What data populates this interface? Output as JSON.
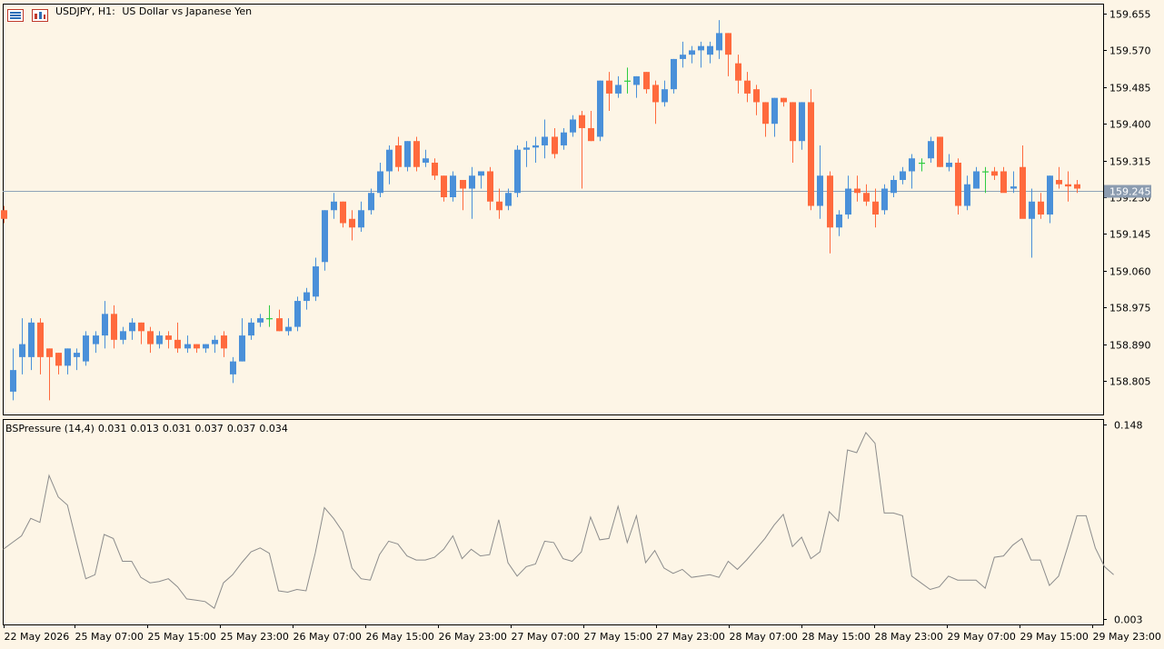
{
  "header": {
    "symbol": "USDJPY, H1:",
    "description": "US Dollar vs Japanese Yen"
  },
  "indicator": {
    "name": "BSPressure (14,4)",
    "values": [
      "0.031",
      "0.013",
      "0.031",
      "0.037",
      "0.037",
      "0.034"
    ]
  },
  "icons": [
    "menu-list-icon",
    "chart-window-icon"
  ],
  "colors": {
    "background": "#fdf5e6",
    "bull": "#4a90d9",
    "bear": "#ff6a3d",
    "doji": "#2ecc40",
    "price_line": "#8fa3b8",
    "grid_border": "#000000",
    "indicator_line": "#8c8c8c",
    "current_price_bg": "#8c9cb0"
  },
  "chart_data": [
    {
      "type": "candlestick",
      "symbol": "USDJPY",
      "timeframe": "H1",
      "title": "USDJPY, H1:  US Dollar vs Japanese Yen",
      "y_ticks": [
        "159.655",
        "159.570",
        "159.485",
        "159.400",
        "159.315",
        "159.230",
        "159.145",
        "159.060",
        "158.975",
        "158.890",
        "158.805"
      ],
      "ylim": [
        158.74,
        159.665
      ],
      "current_price": "159.245",
      "x_ticks": [
        "22 May 2026",
        "25 May 07:00",
        "25 May 15:00",
        "25 May 23:00",
        "26 May 07:00",
        "26 May 15:00",
        "26 May 23:00",
        "27 May 07:00",
        "27 May 15:00",
        "27 May 23:00",
        "28 May 07:00",
        "28 May 15:00",
        "28 May 23:00",
        "29 May 07:00",
        "29 May 15:00",
        "29 May 23:00"
      ],
      "candles": [
        [
          159.2,
          159.21,
          159.17,
          159.18
        ],
        [
          158.78,
          158.88,
          158.76,
          158.83
        ],
        [
          158.86,
          158.95,
          158.82,
          158.89
        ],
        [
          158.86,
          158.95,
          158.83,
          158.94
        ],
        [
          158.94,
          158.95,
          158.82,
          158.86
        ],
        [
          158.88,
          158.88,
          158.76,
          158.86
        ],
        [
          158.87,
          158.87,
          158.82,
          158.84
        ],
        [
          158.84,
          158.88,
          158.82,
          158.88
        ],
        [
          158.86,
          158.88,
          158.83,
          158.87
        ],
        [
          158.85,
          158.92,
          158.84,
          158.91
        ],
        [
          158.89,
          158.92,
          158.87,
          158.91
        ],
        [
          158.91,
          158.99,
          158.88,
          158.96
        ],
        [
          158.96,
          158.98,
          158.88,
          158.9
        ],
        [
          158.9,
          158.93,
          158.89,
          158.92
        ],
        [
          158.92,
          158.95,
          158.9,
          158.94
        ],
        [
          158.94,
          158.94,
          158.89,
          158.92
        ],
        [
          158.92,
          158.93,
          158.87,
          158.89
        ],
        [
          158.89,
          158.92,
          158.88,
          158.91
        ],
        [
          158.91,
          158.92,
          158.88,
          158.9
        ],
        [
          158.9,
          158.94,
          158.87,
          158.88
        ],
        [
          158.88,
          158.91,
          158.87,
          158.89
        ],
        [
          158.89,
          158.89,
          158.87,
          158.88
        ],
        [
          158.88,
          158.89,
          158.87,
          158.89
        ],
        [
          158.89,
          158.91,
          158.87,
          158.9
        ],
        [
          158.91,
          158.92,
          158.86,
          158.88
        ],
        [
          158.82,
          158.86,
          158.8,
          158.85
        ],
        [
          158.85,
          158.95,
          158.85,
          158.91
        ],
        [
          158.91,
          158.95,
          158.9,
          158.94
        ],
        [
          158.94,
          158.96,
          158.93,
          158.95
        ],
        [
          158.95,
          158.98,
          158.93,
          158.95
        ],
        [
          158.95,
          158.97,
          158.92,
          158.92
        ],
        [
          158.92,
          158.95,
          158.91,
          158.93
        ],
        [
          158.93,
          159.0,
          158.92,
          158.99
        ],
        [
          158.99,
          159.02,
          158.97,
          159.01
        ],
        [
          159.0,
          159.09,
          158.99,
          159.07
        ],
        [
          159.08,
          159.2,
          159.06,
          159.2
        ],
        [
          159.2,
          159.24,
          159.18,
          159.22
        ],
        [
          159.22,
          159.22,
          159.16,
          159.17
        ],
        [
          159.18,
          159.2,
          159.13,
          159.16
        ],
        [
          159.16,
          159.22,
          159.15,
          159.2
        ],
        [
          159.2,
          159.25,
          159.19,
          159.24
        ],
        [
          159.24,
          159.31,
          159.23,
          159.29
        ],
        [
          159.29,
          159.35,
          159.26,
          159.34
        ],
        [
          159.35,
          159.37,
          159.29,
          159.3
        ],
        [
          159.3,
          159.36,
          159.29,
          159.36
        ],
        [
          159.36,
          159.37,
          159.29,
          159.3
        ],
        [
          159.31,
          159.34,
          159.3,
          159.32
        ],
        [
          159.31,
          159.32,
          159.27,
          159.28
        ],
        [
          159.28,
          159.28,
          159.22,
          159.23
        ],
        [
          159.23,
          159.29,
          159.22,
          159.28
        ],
        [
          159.27,
          159.27,
          159.2,
          159.25
        ],
        [
          159.25,
          159.3,
          159.18,
          159.28
        ],
        [
          159.28,
          159.29,
          159.25,
          159.29
        ],
        [
          159.29,
          159.3,
          159.2,
          159.22
        ],
        [
          159.22,
          159.25,
          159.18,
          159.2
        ],
        [
          159.21,
          159.25,
          159.2,
          159.24
        ],
        [
          159.24,
          159.35,
          159.23,
          159.34
        ],
        [
          159.34,
          159.36,
          159.3,
          159.345
        ],
        [
          159.345,
          159.37,
          159.31,
          159.35
        ],
        [
          159.35,
          159.41,
          159.32,
          159.37
        ],
        [
          159.37,
          159.39,
          159.32,
          159.33
        ],
        [
          159.35,
          159.39,
          159.34,
          159.38
        ],
        [
          159.38,
          159.42,
          159.37,
          159.41
        ],
        [
          159.42,
          159.43,
          159.25,
          159.39
        ],
        [
          159.39,
          159.43,
          159.36,
          159.36
        ],
        [
          159.37,
          159.5,
          159.36,
          159.5
        ],
        [
          159.5,
          159.52,
          159.43,
          159.47
        ],
        [
          159.47,
          159.51,
          159.46,
          159.49
        ],
        [
          159.5,
          159.53,
          159.47,
          159.5
        ],
        [
          159.49,
          159.51,
          159.46,
          159.51
        ],
        [
          159.52,
          159.52,
          159.47,
          159.48
        ],
        [
          159.49,
          159.5,
          159.4,
          159.45
        ],
        [
          159.45,
          159.5,
          159.44,
          159.48
        ],
        [
          159.48,
          159.55,
          159.47,
          159.55
        ],
        [
          159.55,
          159.59,
          159.53,
          159.56
        ],
        [
          159.56,
          159.58,
          159.54,
          159.57
        ],
        [
          159.57,
          159.59,
          159.53,
          159.58
        ],
        [
          159.56,
          159.59,
          159.54,
          159.58
        ],
        [
          159.57,
          159.64,
          159.55,
          159.61
        ],
        [
          159.61,
          159.61,
          159.51,
          159.56
        ],
        [
          159.54,
          159.56,
          159.47,
          159.5
        ],
        [
          159.5,
          159.52,
          159.45,
          159.47
        ],
        [
          159.48,
          159.49,
          159.42,
          159.45
        ],
        [
          159.45,
          159.45,
          159.37,
          159.4
        ],
        [
          159.4,
          159.46,
          159.37,
          159.46
        ],
        [
          159.46,
          159.46,
          159.44,
          159.45
        ],
        [
          159.45,
          159.45,
          159.31,
          159.36
        ],
        [
          159.36,
          159.45,
          159.34,
          159.45
        ],
        [
          159.45,
          159.48,
          159.2,
          159.21
        ],
        [
          159.21,
          159.35,
          159.18,
          159.28
        ],
        [
          159.28,
          159.29,
          159.1,
          159.16
        ],
        [
          159.16,
          159.2,
          159.14,
          159.19
        ],
        [
          159.19,
          159.28,
          159.18,
          159.25
        ],
        [
          159.25,
          159.28,
          159.22,
          159.24
        ],
        [
          159.24,
          159.26,
          159.21,
          159.22
        ],
        [
          159.22,
          159.25,
          159.16,
          159.19
        ],
        [
          159.2,
          159.26,
          159.19,
          159.25
        ],
        [
          159.24,
          159.28,
          159.23,
          159.27
        ],
        [
          159.27,
          159.3,
          159.26,
          159.29
        ],
        [
          159.29,
          159.33,
          159.25,
          159.32
        ],
        [
          159.31,
          159.32,
          159.29,
          159.31
        ],
        [
          159.32,
          159.37,
          159.31,
          159.36
        ],
        [
          159.37,
          159.37,
          159.3,
          159.3
        ],
        [
          159.3,
          159.33,
          159.29,
          159.31
        ],
        [
          159.31,
          159.32,
          159.19,
          159.21
        ],
        [
          159.21,
          159.28,
          159.2,
          159.26
        ],
        [
          159.25,
          159.3,
          159.25,
          159.29
        ],
        [
          159.29,
          159.3,
          159.24,
          159.29
        ],
        [
          159.29,
          159.3,
          159.27,
          159.28
        ],
        [
          159.29,
          159.3,
          159.25,
          159.24
        ],
        [
          159.25,
          159.29,
          159.24,
          159.255
        ],
        [
          159.3,
          159.35,
          159.21,
          159.18
        ],
        [
          159.18,
          159.25,
          159.09,
          159.22
        ],
        [
          159.22,
          159.24,
          159.18,
          159.19
        ],
        [
          159.19,
          159.28,
          159.17,
          159.28
        ],
        [
          159.27,
          159.3,
          159.25,
          159.26
        ],
        [
          159.26,
          159.29,
          159.22,
          159.255
        ],
        [
          159.26,
          159.27,
          159.24,
          159.25
        ]
      ]
    },
    {
      "type": "line",
      "title": "BSPressure (14,4)",
      "y_ticks": [
        "0.148",
        "0.003"
      ],
      "ylim": [
        0.003,
        0.148
      ],
      "values": [
        0.055,
        0.06,
        0.065,
        0.078,
        0.075,
        0.11,
        0.094,
        0.088,
        0.06,
        0.033,
        0.036,
        0.066,
        0.063,
        0.046,
        0.046,
        0.034,
        0.03,
        0.031,
        0.033,
        0.027,
        0.018,
        0.017,
        0.016,
        0.011,
        0.03,
        0.036,
        0.045,
        0.053,
        0.056,
        0.052,
        0.024,
        0.023,
        0.025,
        0.024,
        0.052,
        0.086,
        0.078,
        0.068,
        0.041,
        0.033,
        0.032,
        0.051,
        0.061,
        0.059,
        0.05,
        0.047,
        0.047,
        0.049,
        0.055,
        0.065,
        0.048,
        0.055,
        0.05,
        0.051,
        0.077,
        0.045,
        0.035,
        0.042,
        0.044,
        0.061,
        0.06,
        0.048,
        0.046,
        0.053,
        0.079,
        0.062,
        0.063,
        0.087,
        0.06,
        0.08,
        0.045,
        0.054,
        0.041,
        0.037,
        0.04,
        0.034,
        0.035,
        0.036,
        0.034,
        0.046,
        0.04,
        0.047,
        0.055,
        0.063,
        0.073,
        0.081,
        0.057,
        0.064,
        0.048,
        0.053,
        0.083,
        0.076,
        0.129,
        0.127,
        0.142,
        0.134,
        0.082,
        0.082,
        0.08,
        0.035,
        0.03,
        0.025,
        0.027,
        0.035,
        0.032,
        0.032,
        0.032,
        0.026,
        0.049,
        0.05,
        0.058,
        0.063,
        0.047,
        0.047,
        0.028,
        0.035,
        0.057,
        0.08,
        0.08,
        0.056,
        0.042,
        0.036
      ]
    }
  ]
}
